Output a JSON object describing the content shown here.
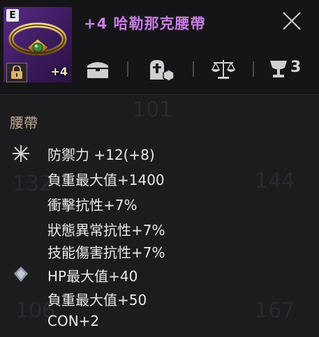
{
  "item": {
    "grade": "E",
    "enhance_level": "+4",
    "name": "+4 哈勒那克腰帶",
    "icons": [
      "lock-icon",
      "belt-icon"
    ]
  },
  "header": {
    "close_icon": "close-icon",
    "actions": [
      {
        "name": "storage-chest-icon"
      },
      {
        "name": "grave-transfer-icon"
      },
      {
        "name": "balance-scale-icon"
      },
      {
        "name": "collection-goblet-icon",
        "count": "3"
      }
    ]
  },
  "background_numbers": [
    "101",
    "132",
    "144",
    "106",
    "167"
  ],
  "section": {
    "title": "腰帶"
  },
  "base_stats": [
    "防禦力 +12(+8)",
    "負重最大值+1400",
    "衝擊抗性+7%",
    "狀態異常抗性+7%",
    "技能傷害抗性+7%"
  ],
  "bonus_stats": [
    "HP最大值+40",
    "負重最大值+50",
    "CON+2"
  ],
  "colors": {
    "item_name": "#c77fe0",
    "section_title": "#c4a88e",
    "slot_purple": "#5a2c86"
  }
}
